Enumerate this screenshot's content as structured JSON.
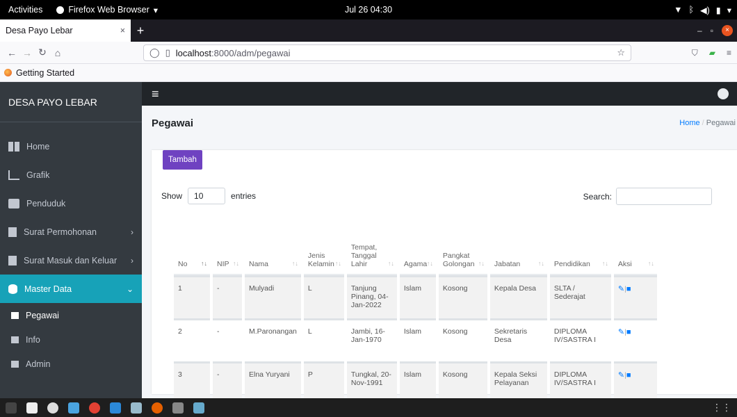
{
  "system": {
    "activities": "Activities",
    "app_menu": "Firefox Web Browser",
    "clock": "Jul 26  04:30"
  },
  "browser": {
    "tab_title": "Desa Payo Lebar",
    "url_host": "localhost",
    "url_path": ":8000/adm/pegawai",
    "bookmark": "Getting Started"
  },
  "app": {
    "brand": "DESA PAYO LEBAR",
    "menu": [
      {
        "label": "Home",
        "icon": "dashboard-icon"
      },
      {
        "label": "Grafik",
        "icon": "chart-icon"
      },
      {
        "label": "Penduduk",
        "icon": "user-plus-icon"
      },
      {
        "label": "Surat Permohonan",
        "icon": "file-icon"
      },
      {
        "label": "Surat Masuk dan Keluar",
        "icon": "file-icon"
      },
      {
        "label": "Master Data",
        "icon": "database-icon"
      }
    ],
    "submenu": [
      "Pegawai",
      "Info",
      "Admin"
    ],
    "page_title": "Pegawai",
    "breadcrumb": {
      "home": "Home",
      "current": "Pegawai"
    },
    "add_button": "Tambah",
    "show_label": "Show",
    "entries_value": "10",
    "entries_label": "entries",
    "search_label": "Search:",
    "table": {
      "headers": [
        "No",
        "NIP",
        "Nama",
        "Jenis Kelamin",
        "Tempat, Tanggal Lahir",
        "Agama",
        "Pangkat Golongan",
        "Jabatan",
        "Pendidikan",
        "Aksi"
      ],
      "rows": [
        [
          "1",
          "-",
          "Mulyadi",
          "L",
          "Tanjung Pinang, 04-Jan-2022",
          "Islam",
          "Kosong",
          "Kepala Desa",
          "SLTA / Sederajat"
        ],
        [
          "2",
          "-",
          "M.Paronangan",
          "L",
          "Jambi, 16-Jan-1970",
          "Islam",
          "Kosong",
          "Sekretaris Desa",
          "DIPLOMA IV/SASTRA I"
        ],
        [
          "3",
          "-",
          "Elna Yuryani",
          "P",
          "Tungkal, 20-Nov-1991",
          "Islam",
          "Kosong",
          "Kepala Seksi Pelayanan",
          "DIPLOMA IV/SASTRA I"
        ]
      ]
    }
  }
}
